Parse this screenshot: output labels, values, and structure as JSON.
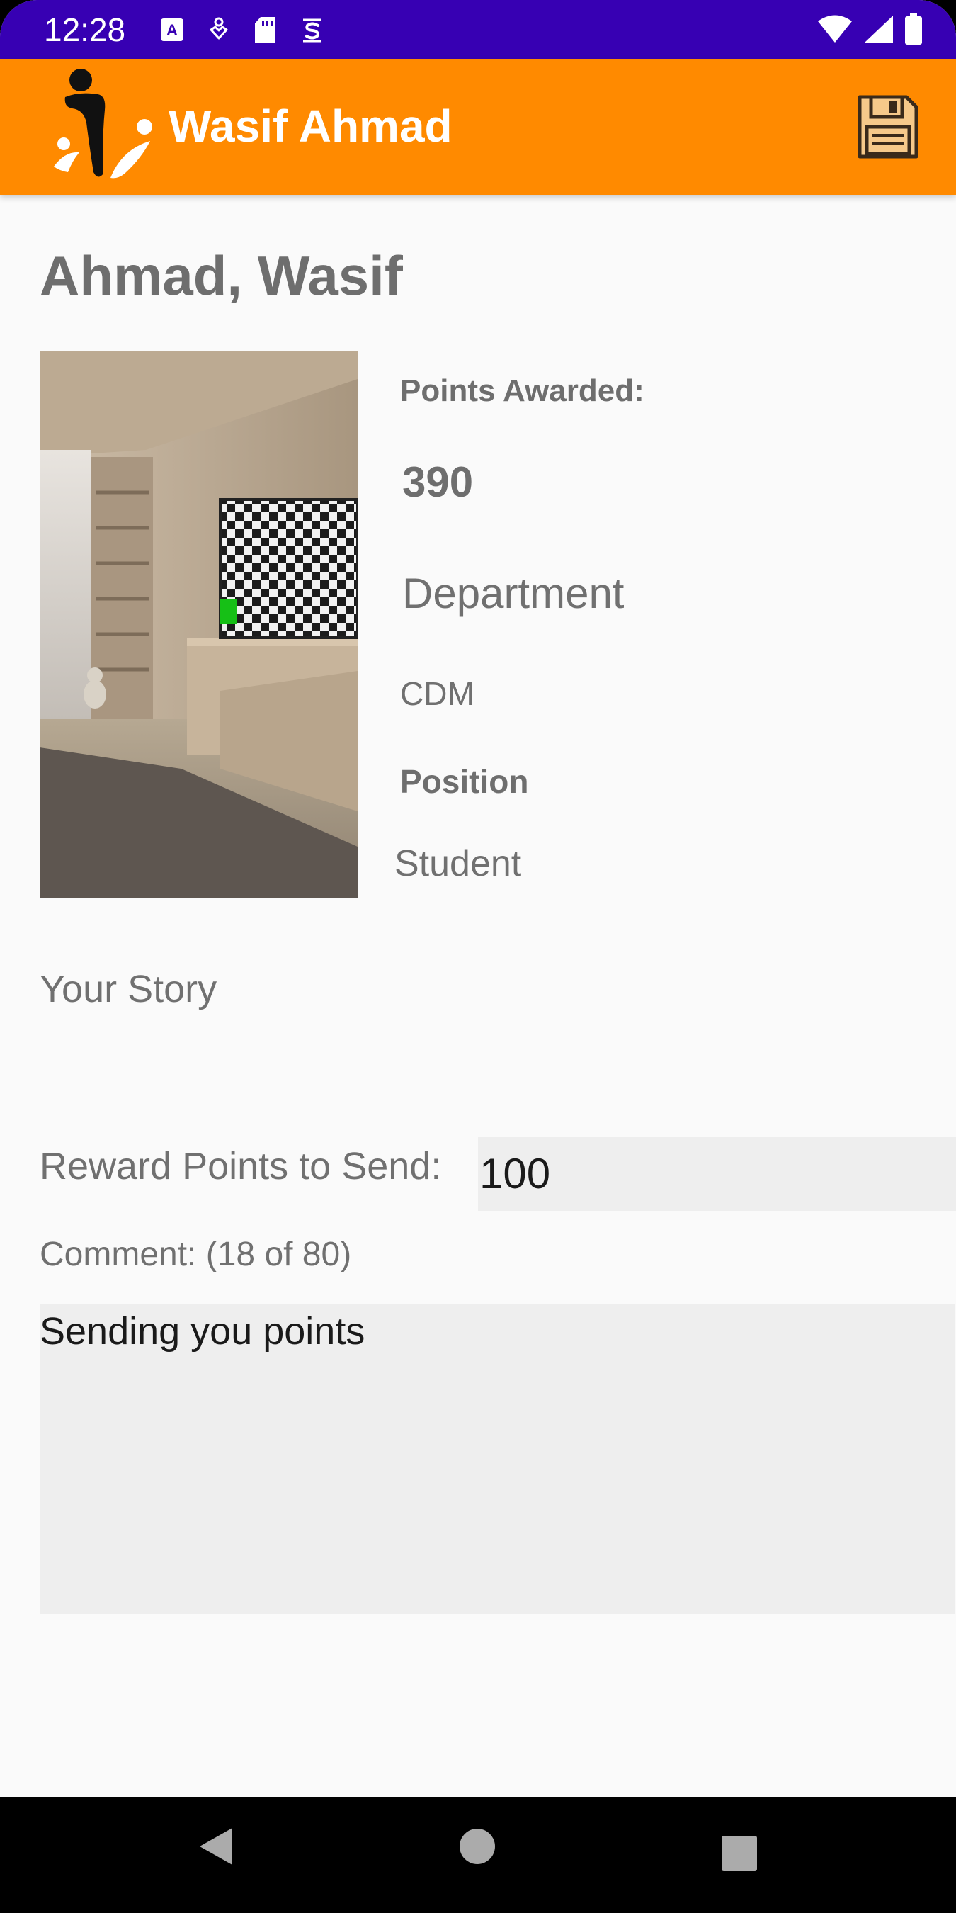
{
  "status_bar": {
    "time": "12:28",
    "icons_left": [
      "accessibility-a-icon",
      "heart-location-icon",
      "sd-card-icon",
      "signal-s-icon"
    ],
    "icons_right": [
      "wifi-icon",
      "cell-signal-icon",
      "battery-icon"
    ],
    "background": "#3700b3"
  },
  "app_bar": {
    "title": "Wasif Ahmad",
    "background": "#ff8a00",
    "save_icon": "floppy-disk-save-icon"
  },
  "profile": {
    "name": "Ahmad, Wasif",
    "points_label": "Points Awarded:",
    "points_value": "390",
    "department_label": "Department",
    "department_value": "CDM",
    "position_label": "Position",
    "position_value": "Student"
  },
  "story": {
    "label": "Your Story"
  },
  "reward": {
    "label": "Reward Points to Send:",
    "value": "100"
  },
  "comment": {
    "label": "Comment: (18 of 80)",
    "value": "Sending you points"
  },
  "nav_bar": {
    "icons": [
      "back-triangle-icon",
      "home-circle-icon",
      "recents-square-icon"
    ]
  }
}
